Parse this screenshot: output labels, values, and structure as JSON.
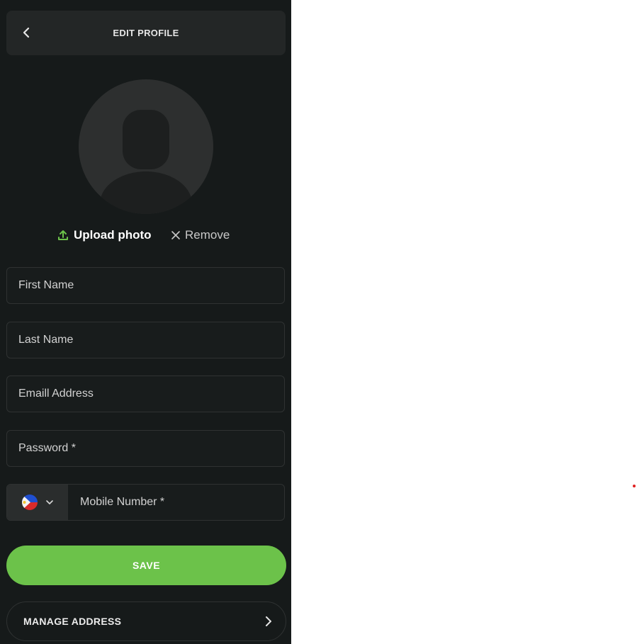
{
  "header": {
    "title": "EDIT PROFILE",
    "back_icon": "chevron-left-icon"
  },
  "avatar": {
    "icon": "user-silhouette-icon"
  },
  "photo_actions": {
    "upload_label": "Upload photo",
    "upload_icon": "upload-icon",
    "upload_icon_color": "#6cc24a",
    "remove_label": "Remove",
    "remove_icon": "close-icon"
  },
  "form": {
    "first_name": {
      "value": "",
      "placeholder": "First Name"
    },
    "last_name": {
      "value": "",
      "placeholder": "Last Name"
    },
    "email": {
      "value": "",
      "placeholder": "Emaill Address"
    },
    "password": {
      "value": "",
      "placeholder": "Password *"
    },
    "mobile": {
      "value": "",
      "placeholder": "Mobile Number *",
      "country_flag_icon": "philippines-flag-icon",
      "dropdown_icon": "chevron-down-icon"
    }
  },
  "actions": {
    "save_label": "SAVE",
    "manage_address_label": "MANAGE ADDRESS",
    "manage_address_icon": "chevron-right-icon"
  },
  "colors": {
    "background": "#161a1a",
    "header": "#232626",
    "accent": "#6cc24a",
    "field_border": "#2f3232",
    "marker": "#e02020"
  }
}
